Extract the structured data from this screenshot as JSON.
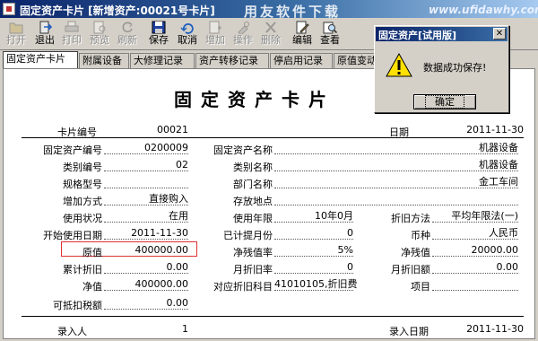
{
  "window": {
    "title": "固定资产卡片 [新增资产:00021号卡片]",
    "watermark": "用友软件下载",
    "watermark_url": "www.ufidawhy.com"
  },
  "toolbar": [
    {
      "label": "打开",
      "icon": "folder-open-icon",
      "enabled": false
    },
    {
      "label": "退出",
      "icon": "exit-icon",
      "enabled": true
    },
    {
      "label": "打印",
      "icon": "printer-icon",
      "enabled": false
    },
    {
      "label": "预览",
      "icon": "preview-icon",
      "enabled": false
    },
    {
      "label": "刷新",
      "icon": "refresh-icon",
      "enabled": false
    },
    {
      "label": "保存",
      "icon": "save-icon",
      "enabled": true
    },
    {
      "label": "取消",
      "icon": "cancel-icon",
      "enabled": true
    },
    {
      "label": "增加",
      "icon": "add-icon",
      "enabled": false
    },
    {
      "label": "操作",
      "icon": "operate-icon",
      "enabled": false
    },
    {
      "label": "删除",
      "icon": "delete-icon",
      "enabled": false
    },
    {
      "label": "编辑",
      "icon": "edit-icon",
      "enabled": true
    },
    {
      "label": "查看",
      "icon": "view-icon",
      "enabled": true
    }
  ],
  "tabs": [
    "固定资产卡片",
    "附属设备",
    "大修理记录",
    "资产转移记录",
    "停启用记录",
    "原值变动"
  ],
  "card": {
    "title": "固定资产卡片",
    "card_no_label": "卡片编号",
    "card_no": "00021",
    "date_label": "日期",
    "date": "2011-11-30",
    "fields": {
      "asset_code_label": "固定资产编号",
      "asset_code": "0200009",
      "asset_name_label": "固定资产名称",
      "asset_name": "机器设备",
      "category_code_label": "类别编号",
      "category_code": "02",
      "category_name_label": "类别名称",
      "category_name": "机器设备",
      "spec_label": "规格型号",
      "spec": "",
      "dept_label": "部门名称",
      "dept": "金工车间",
      "add_method_label": "增加方式",
      "add_method": "直接购入",
      "location_label": "存放地点",
      "location": "",
      "usage_label": "使用状况",
      "usage": "在用",
      "life_label": "使用年限",
      "life": "10年0月",
      "depr_method_label": "折旧方法",
      "depr_method": "平均年限法(一)",
      "start_date_label": "开始使用日期",
      "start_date": "2011-11-30",
      "accrued_months_label": "已计提月份",
      "accrued_months": "0",
      "currency_label": "币种",
      "currency": "人民币",
      "original_value_label": "原值",
      "original_value": "400000.00",
      "salvage_rate_label": "净残值率",
      "salvage_rate": "5%",
      "salvage_value_label": "净残值",
      "salvage_value": "20000.00",
      "accum_depr_label": "累计折旧",
      "accum_depr": "0.00",
      "monthly_rate_label": "月折旧率",
      "monthly_rate": "0",
      "monthly_depr_label": "月折旧额",
      "monthly_depr": "0.00",
      "net_value_label": "净值",
      "net_value": "400000.00",
      "depr_account_label": "对应折旧科目",
      "depr_account": "41010105,折旧费",
      "project_label": "项目",
      "project": "",
      "deductible_tax_label": "可抵扣税额",
      "deductible_tax": "0.00"
    },
    "entered_by_label": "录入人",
    "entered_by": "1",
    "entry_date_label": "录入日期",
    "entry_date": "2011-11-30"
  },
  "dialog": {
    "title": "固定资产[试用版]",
    "message": "数据成功保存!",
    "ok_label": "确定",
    "icon": "warning-icon"
  },
  "colors": {
    "titlebar": "#0a246a",
    "highlight_box": "#e03030",
    "face": "#d4d0c8"
  }
}
